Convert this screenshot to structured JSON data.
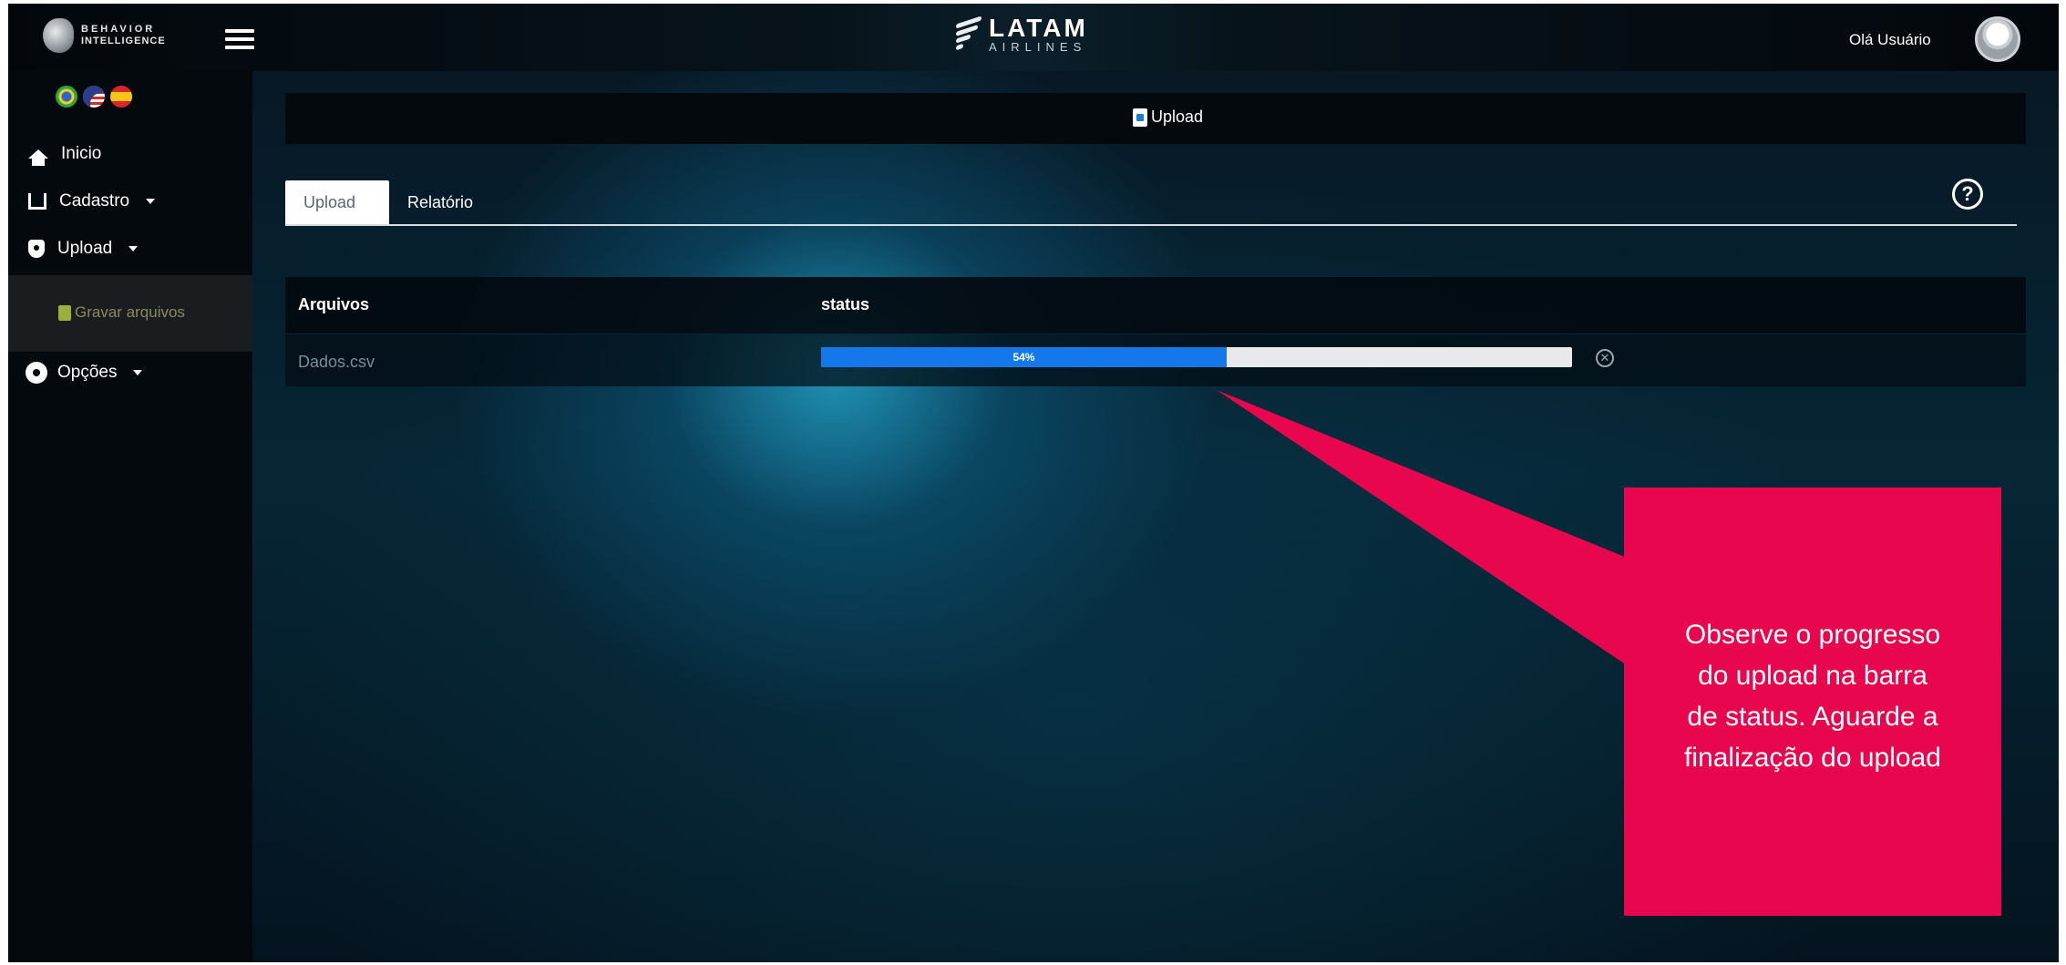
{
  "header": {
    "brand_line1": "BEHAVIOR",
    "brand_line2": "INTELLIGENCE",
    "logo_name": "LATAM",
    "logo_sub": "AIRLINES",
    "greeting": "Olá Usuário"
  },
  "languages": [
    "pt-BR",
    "en-US",
    "es-ES"
  ],
  "sidebar": {
    "items": [
      {
        "label": "Inicio",
        "icon": "home-icon"
      },
      {
        "label": "Cadastro",
        "icon": "book-icon"
      },
      {
        "label": "Upload",
        "icon": "shield-icon"
      },
      {
        "label": "Opções",
        "icon": "gear-icon"
      }
    ],
    "sub_item": {
      "label": "Gravar arquivos",
      "icon": "file-icon"
    }
  },
  "page": {
    "title": "Upload"
  },
  "tabs": [
    {
      "label": "Upload",
      "active": true
    },
    {
      "label": "Relatório",
      "active": false
    }
  ],
  "table": {
    "headers": [
      "Arquivos",
      "status"
    ],
    "rows": [
      {
        "file": "Dados.csv",
        "progress": 0.54,
        "progress_label": "54%"
      }
    ]
  },
  "callout": {
    "text": "Observe  o progresso\ndo upload na barra\nde status. Aguarde a\nfinalização do upload"
  },
  "colors": {
    "accent_blue": "#1478ea",
    "callout_pink": "#e8074e",
    "background_dark": "#04090d"
  }
}
